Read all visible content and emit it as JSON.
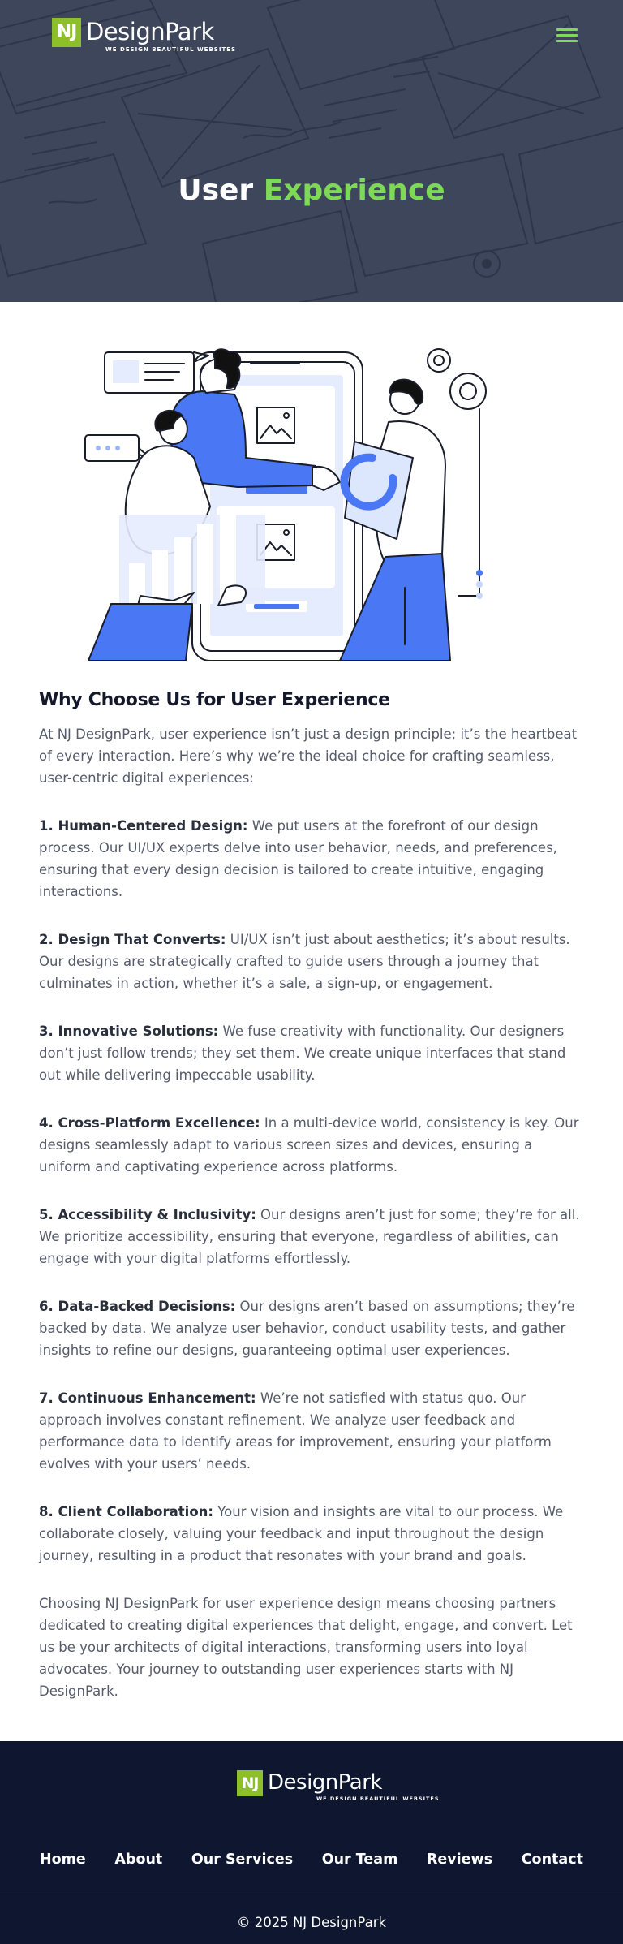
{
  "brand": {
    "mark": "NJ",
    "name": "DesignPark",
    "tagline": "WE DESIGN BEAUTIFUL WEBSITES",
    "accent_color": "#7ed957",
    "mark_color": "#8cbf2a"
  },
  "header": {
    "menu_icon": "hamburger-menu-icon"
  },
  "hero": {
    "title_part1": "User",
    "title_part2": "Experience"
  },
  "main": {
    "heading": "Why Choose Us for User Experience",
    "intro": "At NJ DesignPark, user experience isn’t just a design principle; it’s the heartbeat of every interaction. Here’s why we’re the ideal choice for crafting seamless, user-centric digital experiences:",
    "points": [
      {
        "title": "1. Human-Centered Design:",
        "text": " We put users at the forefront of our design process. Our UI/UX experts delve into user behavior, needs, and preferences, ensuring that every design decision is tailored to create intuitive, engaging interactions."
      },
      {
        "title": "2. Design That Converts:",
        "text": " UI/UX isn’t just about aesthetics; it’s about results. Our designs are strategically crafted to guide users through a journey that culminates in action, whether it’s a sale, a sign-up, or engagement."
      },
      {
        "title": "3. Innovative Solutions:",
        "text": " We fuse creativity with functionality. Our designers don’t just follow trends; they set them. We create unique interfaces that stand out while delivering impeccable usability."
      },
      {
        "title": "4. Cross-Platform Excellence:",
        "text": " In a multi-device world, consistency is key. Our designs seamlessly adapt to various screen sizes and devices, ensuring a uniform and captivating experience across platforms."
      },
      {
        "title": "5. Accessibility & Inclusivity:",
        "text": " Our designs aren’t just for some; they’re for all. We prioritize accessibility, ensuring that everyone, regardless of abilities, can engage with your digital platforms effortlessly."
      },
      {
        "title": "6. Data-Backed Decisions:",
        "text": " Our designs aren’t based on assumptions; they’re backed by data. We analyze user behavior, conduct usability tests, and gather insights to refine our designs, guaranteeing optimal user experiences."
      },
      {
        "title": "7. Continuous Enhancement:",
        "text": " We’re not satisfied with status quo. Our approach involves constant refinement. We analyze user feedback and performance data to identify areas for improvement, ensuring your platform evolves with your users’ needs."
      },
      {
        "title": "8. Client Collaboration:",
        "text": " Your vision and insights are vital to our process. We collaborate closely, valuing your feedback and input throughout the design journey, resulting in a product that resonates with your brand and goals."
      }
    ],
    "closing": "Choosing NJ DesignPark for user experience design means choosing partners dedicated to creating digital experiences that delight, engage, and convert. Let us be your architects of digital interactions, transforming users into loyal advocates. Your journey to outstanding user experiences starts with NJ DesignPark."
  },
  "footer": {
    "nav": [
      "Home",
      "About",
      "Our Services",
      "Our Team",
      "Reviews",
      "Contact"
    ],
    "copyright": "© 2025 NJ DesignPark",
    "background_color": "#0f1730"
  }
}
